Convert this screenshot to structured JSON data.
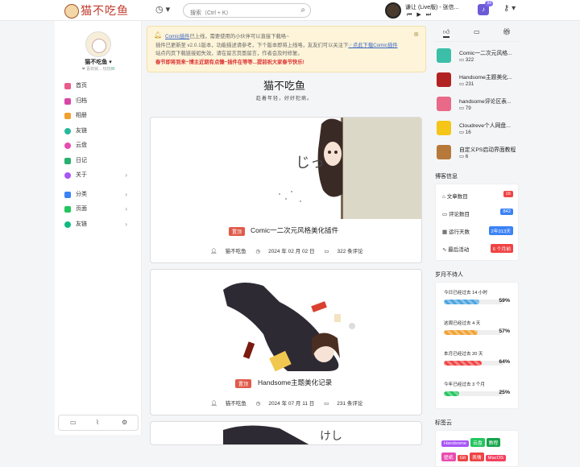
{
  "header": {
    "logo_text": "猫不吃鱼",
    "search_placeholder": "搜索（Ctrl + K）",
    "player_title": "谦让 (Live版) - 张信...",
    "notify_count": "99"
  },
  "profile": {
    "name": "猫不吃鱼",
    "motto_prefix": "❤ 喜欢就... 玩玩",
    "motto_link": "W"
  },
  "nav": {
    "items": [
      {
        "label": "首页",
        "color": "#e85c8c"
      },
      {
        "label": "归档",
        "color": "#d946a8"
      },
      {
        "label": "相册",
        "color": "#f0a030"
      },
      {
        "label": "友链",
        "color": "#28b89c"
      },
      {
        "label": "云盘",
        "color": "#e84bb0"
      },
      {
        "label": "日记",
        "color": "#27b06e"
      },
      {
        "label": "关于",
        "color": "#a855f7"
      }
    ],
    "items2": [
      {
        "label": "分类",
        "color": "#3b82f6"
      },
      {
        "label": "页面",
        "color": "#22c55e"
      },
      {
        "label": "友链",
        "color": "#10b981"
      }
    ]
  },
  "notice": {
    "line1_link": "Comic插件",
    "line1": "已上线，需要使用的小伙伴可以直接下载咯~",
    "line2": "插件已更新至 v2.0.1版本，功能描述请参考，下个版本即将上线咯，友友们可以关注下",
    "line2_link": "☞点此下载Comic插件",
    "line3": "站点内页下载链接如失效，请在留言页面留言，作者会及时修复。",
    "line4": "春节即将到来~博主近期有点懒~插件在等等...提前祝大家春节快乐!"
  },
  "site": {
    "title": "猫不吃鱼",
    "subtitle": "趁着年轻，好好犯病。"
  },
  "posts": [
    {
      "tag": "置顶",
      "title": "Comic一二次元风格美化插件",
      "author": "猫不吃鱼",
      "date": "2024 年 02 月 02 日",
      "comments": "322 条评论"
    },
    {
      "tag": "置顶",
      "title": "Handsome主题美化记录",
      "author": "猫不吃鱼",
      "date": "2024 年 07 月 11 日",
      "comments": "231 条评论"
    }
  ],
  "hot": [
    {
      "title": "Comic一二次元风格...",
      "count": "322",
      "color": "#3bbfa8"
    },
    {
      "title": "Handsome主题美化...",
      "count": "231",
      "color": "#b22222"
    },
    {
      "title": "handsome评论区表...",
      "count": "79",
      "color": "#e86a88"
    },
    {
      "title": "Cloudreve个人网盘...",
      "count": "16",
      "color": "#f5c518"
    },
    {
      "title": "自定义PS启动界面教程",
      "count": "6",
      "color": "#b7793a"
    }
  ],
  "blog_info": {
    "heading": "博客信息",
    "rows": [
      {
        "label": "文章数目",
        "value": "16",
        "color": "#ef4444"
      },
      {
        "label": "评论数目",
        "value": "842",
        "color": "#3b82f6"
      },
      {
        "label": "运行天数",
        "value": "2年313天",
        "color": "#3b82f6"
      },
      {
        "label": "最后活动",
        "value": "6 个月前",
        "color": "#ef4444"
      }
    ]
  },
  "time_progress": {
    "heading": "岁月不待人",
    "rows": [
      {
        "label": "今日已经过去 14 小时",
        "percent": 59,
        "color": "#4aa3df"
      },
      {
        "label": "这周已经过去 4 天",
        "percent": 57,
        "color": "#f0a030"
      },
      {
        "label": "本月已经过去 20 天",
        "percent": 64,
        "color": "#ef4444"
      },
      {
        "label": "今年已经过去 3 个月",
        "percent": 25,
        "color": "#22c55e"
      }
    ]
  },
  "tag_cloud": {
    "heading": "标签云",
    "tags": [
      {
        "label": "Handsome",
        "color": "#a855f7"
      },
      {
        "label": "云盘",
        "color": "#22c55e"
      },
      {
        "label": "教程",
        "color": "#16a34a"
      },
      {
        "label": "壁纸",
        "color": "#e84bb0"
      },
      {
        "label": "Git",
        "color": "#ef4444"
      },
      {
        "label": "表情",
        "color": "#ef4444"
      },
      {
        "label": "MacOS",
        "color": "#f43f5e"
      }
    ]
  }
}
